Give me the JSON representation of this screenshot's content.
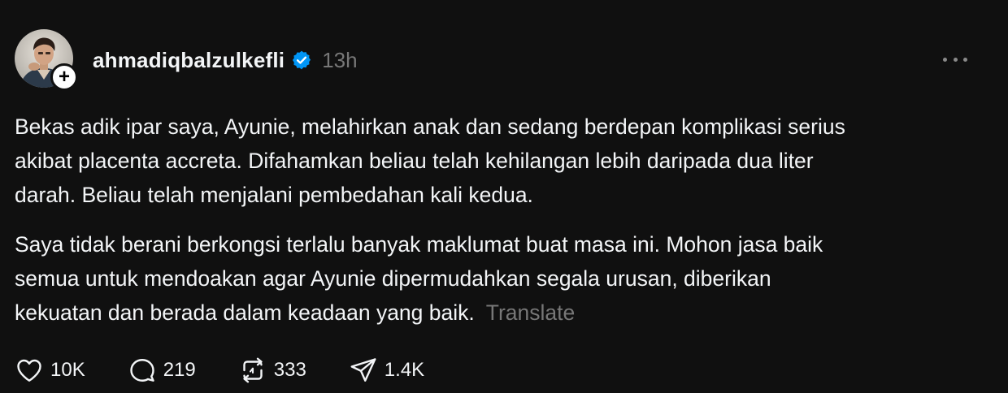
{
  "post": {
    "username": "ahmadiqbalzulkefli",
    "time": "13h",
    "paragraph1": [
      "Bekas adik ipar saya, Ayunie, melahirkan anak dan sedang berdepan komplikasi serius",
      "akibat placenta accreta. Difahamkan beliau telah kehilangan lebih daripada dua liter",
      "darah. Beliau telah menjalani pembedahan kali kedua."
    ],
    "paragraph2": [
      "Saya tidak berani berkongsi terlalu banyak maklumat buat masa ini. Mohon jasa baik",
      "semua untuk mendoakan agar Ayunie dipermudahkan segala urusan, diberikan",
      "kekuatan dan berada dalam keadaan yang baik."
    ],
    "translate_label": "Translate"
  },
  "actions": {
    "likes": "10K",
    "comments": "219",
    "reposts": "333",
    "shares": "1.4K"
  },
  "icons": {
    "verified": "verified-badge-icon",
    "follow": "plus-icon",
    "more": "more-horizontal-icon",
    "like": "heart-icon",
    "comment": "comment-bubble-icon",
    "repost": "repost-icon",
    "share": "send-icon"
  },
  "colors": {
    "background": "#101010",
    "text": "#f3f5f7",
    "muted": "#777777",
    "verified": "#0095f6"
  }
}
